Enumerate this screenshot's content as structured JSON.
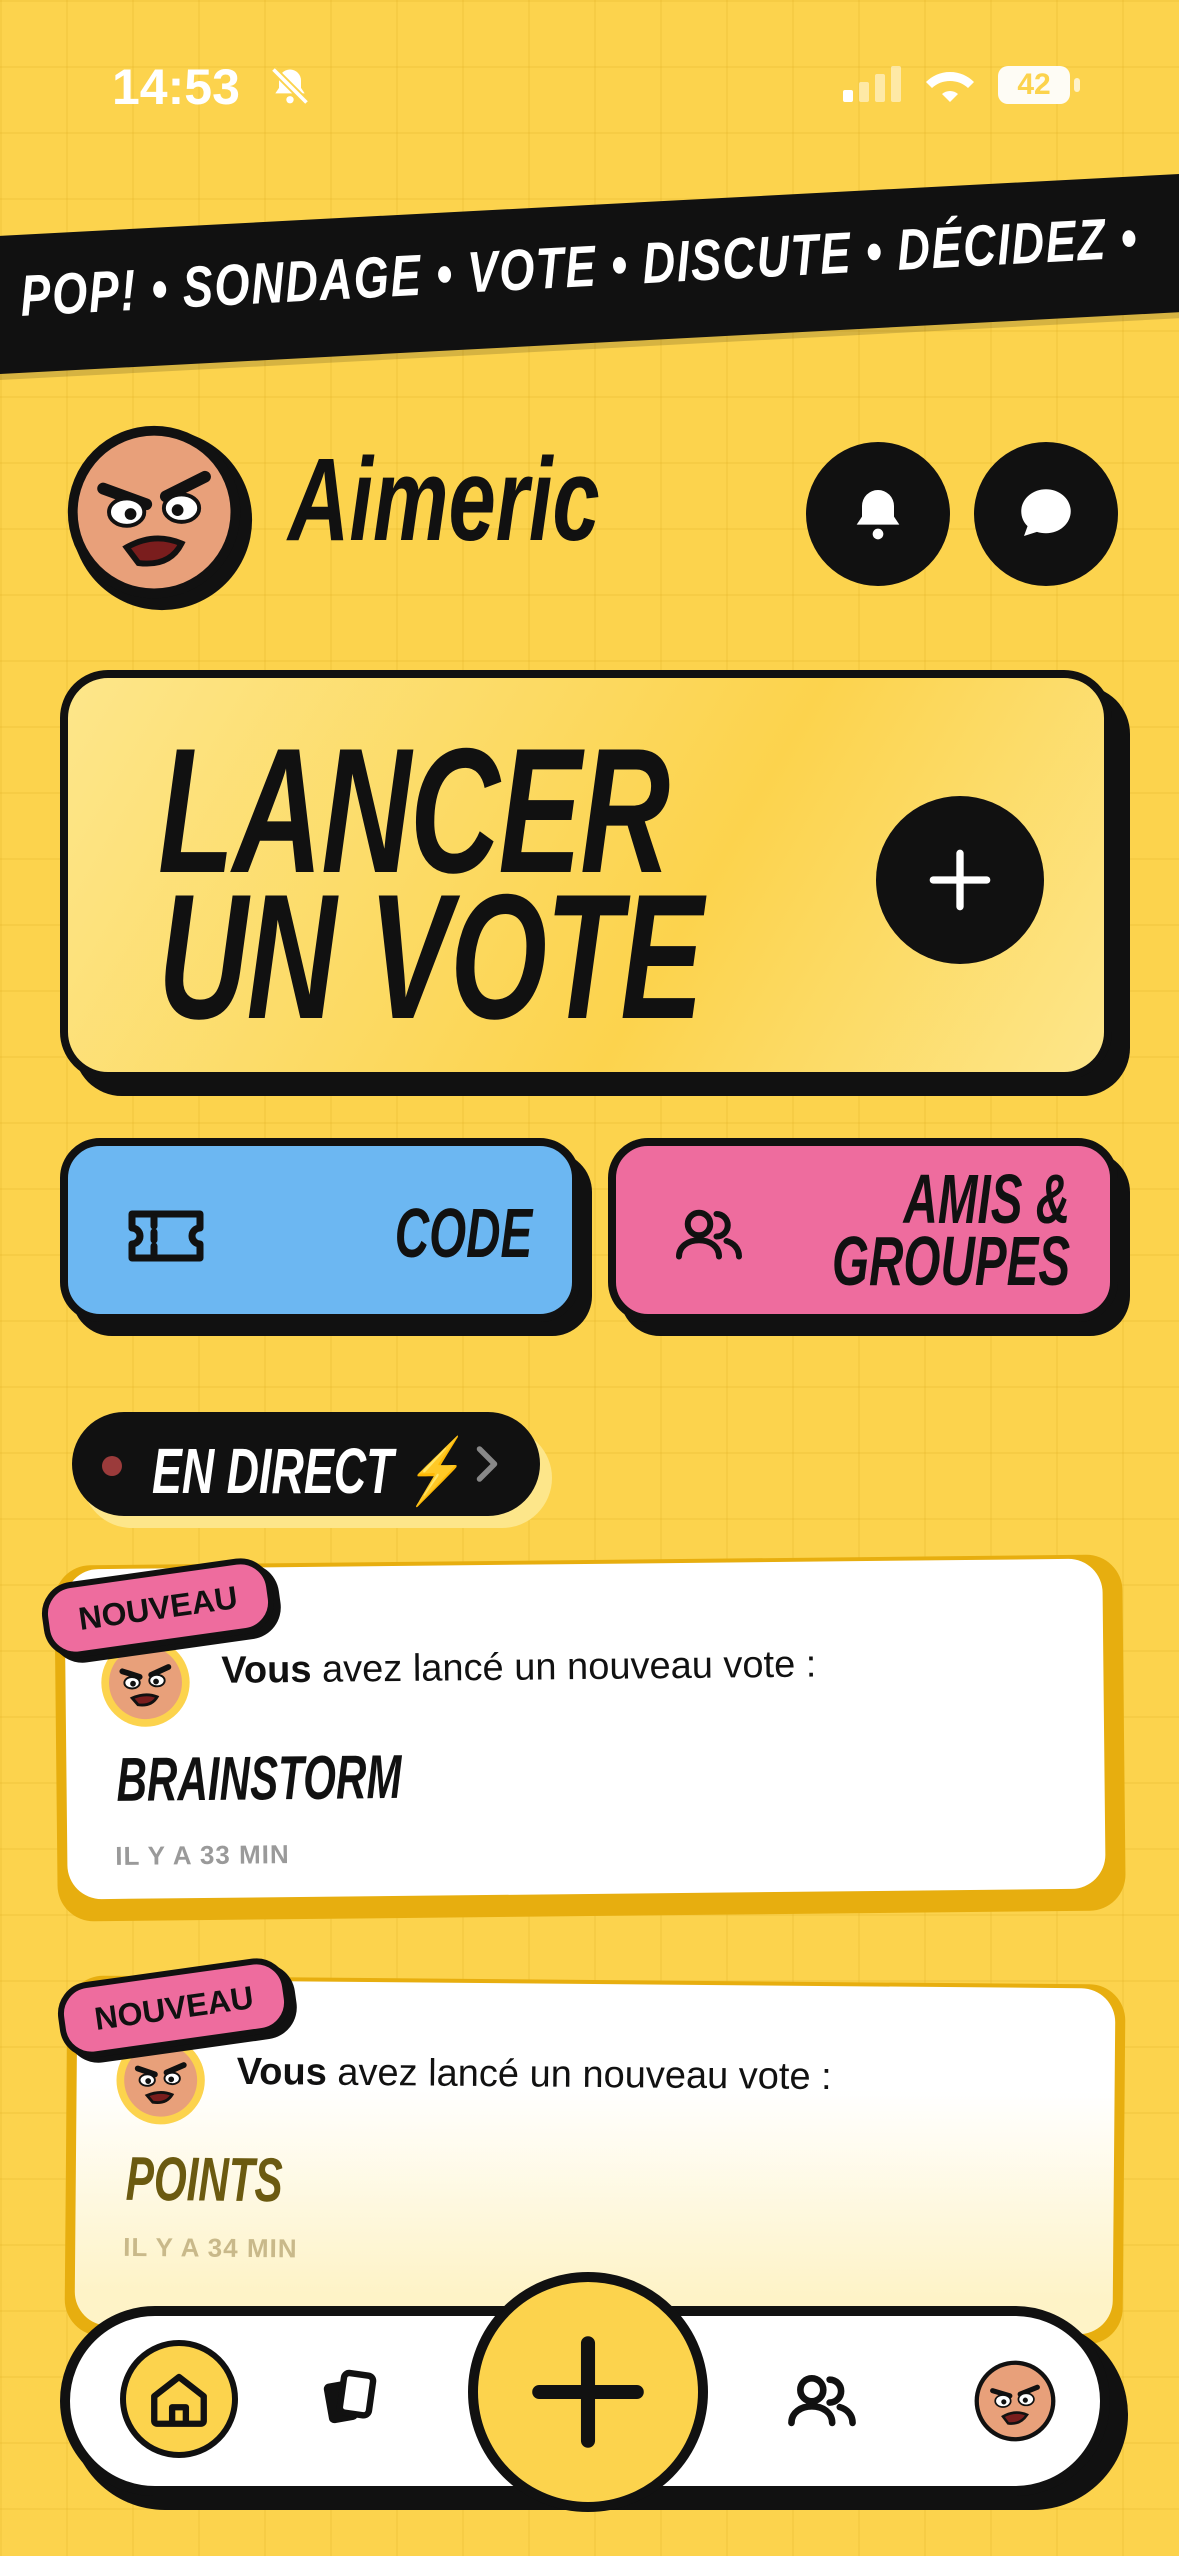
{
  "status_bar": {
    "time": "14:53",
    "battery": "42"
  },
  "ticker": {
    "text": "POP! • SONDAGE • VOTE • DISCUTE • DÉCIDEZ •"
  },
  "profile": {
    "name": "Aimeric"
  },
  "launch": {
    "line1": "LANCER",
    "line2": "UN VOTE"
  },
  "actions": {
    "code_label": "CODE",
    "friends_line1": "AMIS &",
    "friends_line2": "GROUPES"
  },
  "live": {
    "label": "EN DIRECT ⚡"
  },
  "feed": [
    {
      "badge": "NOUVEAU",
      "actor": "Vous",
      "message": " avez lancé un nouveau vote :",
      "title": "BRAINSTORM",
      "time": "IL Y A 33 MIN"
    },
    {
      "badge": "NOUVEAU",
      "actor": "Vous",
      "message": " avez lancé un nouveau vote :",
      "title": "POINTS",
      "time": "IL Y A 34 MIN"
    }
  ],
  "colors": {
    "background": "#fcd34d",
    "code_blue": "#6cb7f2",
    "friends_pink": "#ee6c9e",
    "ink": "#111111"
  },
  "icons": [
    "bell-off-icon",
    "wifi-icon",
    "bell-icon",
    "chat-icon",
    "plus-icon",
    "ticket-icon",
    "friends-icon",
    "chevron-right-icon",
    "home-icon",
    "cards-icon",
    "avatar"
  ]
}
